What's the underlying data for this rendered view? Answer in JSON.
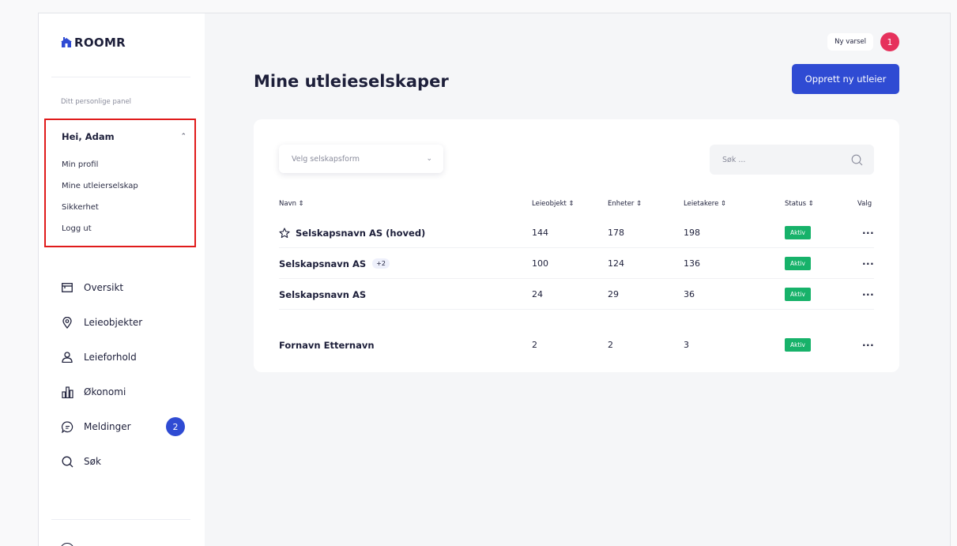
{
  "app": {
    "logo": "ROOMR"
  },
  "sidebar": {
    "panel_label": "Ditt personlige panel",
    "greeting": "Hei, Adam",
    "user_menu": [
      "Min profil",
      "Mine utleierselskap",
      "Sikkerhet",
      "Logg ut"
    ],
    "nav": [
      {
        "label": "Oversikt",
        "icon": "calendar-icon"
      },
      {
        "label": "Leieobjekter",
        "icon": "location-pin-icon"
      },
      {
        "label": "Leieforhold",
        "icon": "user-icon"
      },
      {
        "label": "Økonomi",
        "icon": "bar-chart-icon"
      },
      {
        "label": "Meldinger",
        "icon": "chat-icon",
        "count": "2"
      },
      {
        "label": "Søk",
        "icon": "search-icon"
      }
    ]
  },
  "header": {
    "notification_label": "Ny varsel",
    "notification_count": "1",
    "title": "Mine utleieselskaper",
    "create_button": "Opprett ny utleier"
  },
  "filters": {
    "select_value": "Velg selskapsform",
    "search_placeholder": "Søk ..."
  },
  "table": {
    "columns": [
      "Navn ⇕",
      "Leieobjekt ⇕",
      "Enheter ⇕",
      "Leietakere ⇕",
      "Status ⇕",
      "Valg"
    ],
    "rows": [
      {
        "name": "Selskapsnavn AS (hoved)",
        "starred": true,
        "extra": "",
        "leieobjekt": "144",
        "enheter": "178",
        "leietakere": "198",
        "status": "Aktiv",
        "menu": "···"
      },
      {
        "name": "Selskapsnavn AS",
        "starred": false,
        "extra": "+2",
        "leieobjekt": "100",
        "enheter": "124",
        "leietakere": "136",
        "status": "Aktiv",
        "menu": "···"
      },
      {
        "name": "Selskapsnavn AS",
        "starred": false,
        "extra": "",
        "leieobjekt": "24",
        "enheter": "29",
        "leietakere": "36",
        "status": "Aktiv",
        "menu": "···"
      },
      {
        "name": "Fornavn Etternavn",
        "starred": false,
        "extra": "",
        "leieobjekt": "2",
        "enheter": "2",
        "leietakere": "3",
        "status": "Aktiv",
        "menu": "···"
      }
    ]
  },
  "colors": {
    "primary": "#2f4bd3",
    "status_active": "#17b26a",
    "notification": "#e6315c",
    "highlight_border": "#e01b1b"
  }
}
